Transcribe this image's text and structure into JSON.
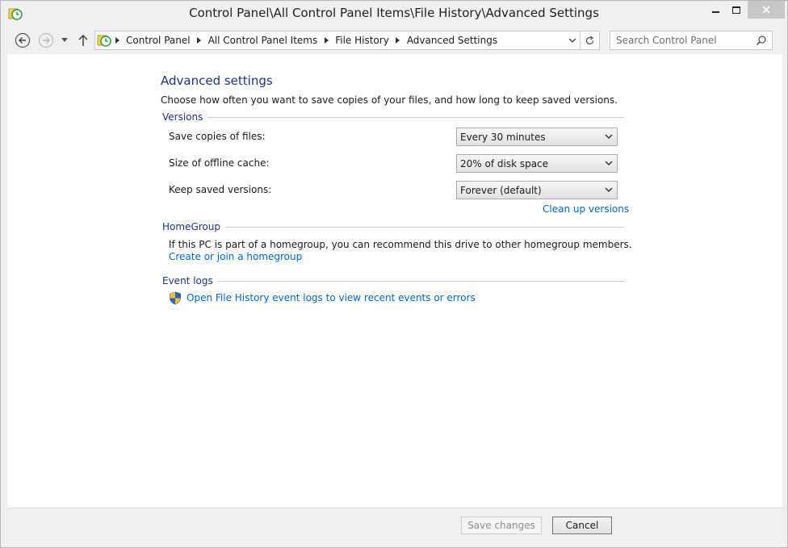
{
  "window": {
    "title": "Control Panel\\All Control Panel Items\\File History\\Advanced Settings"
  },
  "address": {
    "crumbs": [
      "Control Panel",
      "All Control Panel Items",
      "File History",
      "Advanced Settings"
    ]
  },
  "search": {
    "placeholder": "Search Control Panel"
  },
  "main": {
    "title": "Advanced settings",
    "description": "Choose how often you want to save copies of your files, and how long to keep saved versions.",
    "versions": {
      "header": "Versions",
      "rows": [
        {
          "label": "Save copies of files:",
          "value": "Every 30 minutes"
        },
        {
          "label": "Size of offline cache:",
          "value": "20% of disk space"
        },
        {
          "label": "Keep saved versions:",
          "value": "Forever (default)"
        }
      ],
      "cleanup_link": "Clean up versions"
    },
    "homegroup": {
      "header": "HomeGroup",
      "text": "If this PC is part of a homegroup, you can recommend this drive to other homegroup members.",
      "link": "Create or join a homegroup"
    },
    "eventlogs": {
      "header": "Event logs",
      "link": "Open File History event logs to view recent events or errors"
    }
  },
  "footer": {
    "save_label": "Save changes",
    "cancel_label": "Cancel"
  }
}
